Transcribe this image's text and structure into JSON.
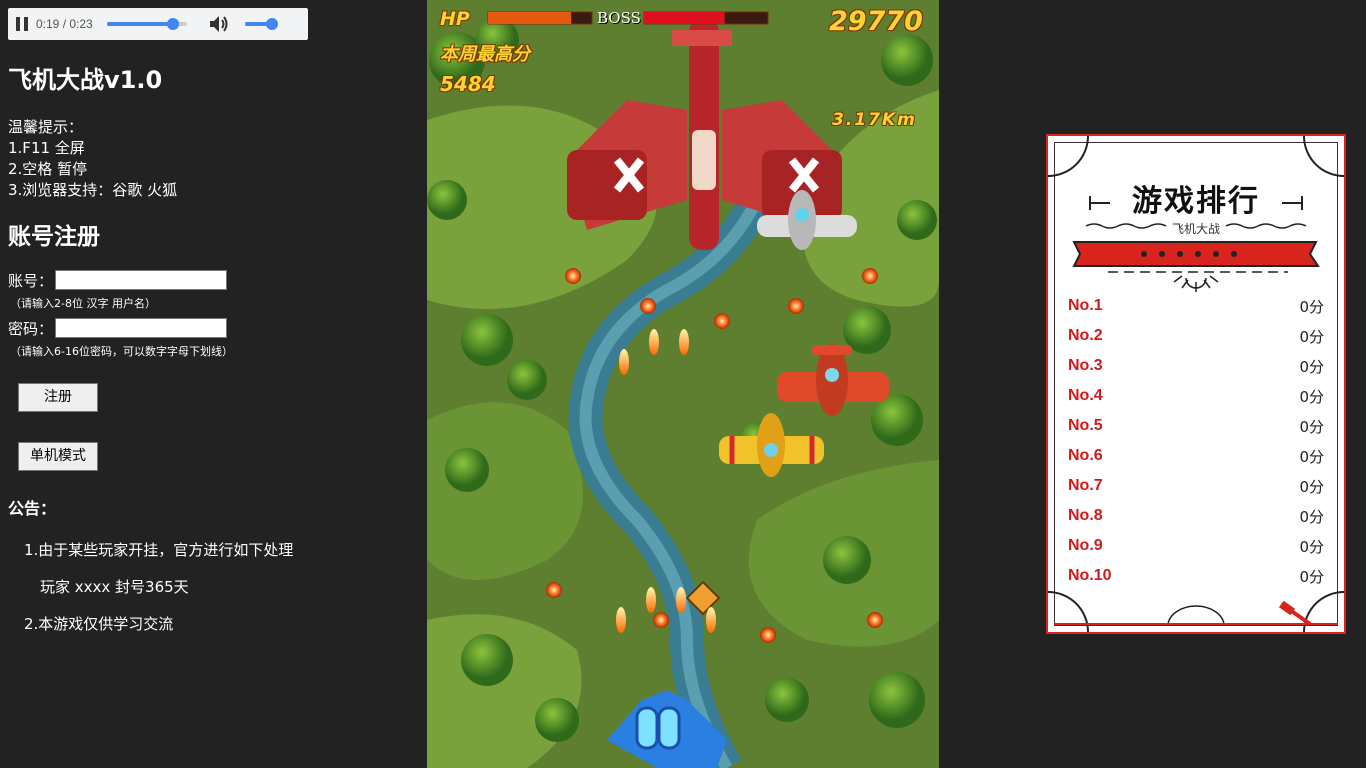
{
  "player": {
    "time": "0:19 / 0:23",
    "progress": 0.83,
    "volume": 0.9
  },
  "left": {
    "title": "飞机大战v1.0",
    "tips": [
      "温馨提示：",
      "1.F11 全屏",
      "2.空格 暂停",
      "3.浏览器支持：谷歌 火狐"
    ],
    "register_heading": "账号注册",
    "account_label": "账号：",
    "account_value": "",
    "account_hint": "（请输入2-8位 汉字 用户名）",
    "password_label": "密码：",
    "password_value": "",
    "password_hint": "（请输入6-16位密码，可以数字字母下划线）",
    "register_button": "注册",
    "single_mode_button": "单机模式",
    "notice_heading": "公告：",
    "notice_1": "1.由于某些玩家开挂，官方进行如下处理",
    "notice_1_detail": "玩家 xxxx 封号365天",
    "notice_2": "2.本游戏仅供学习交流"
  },
  "game": {
    "hp_label": "HP",
    "boss_label": "BOSS",
    "score": "29770",
    "weekly_best_label": "本周最高分",
    "weekly_best": "5484",
    "distance": "3.17Km",
    "player_hp": 0.8,
    "boss_hp": 0.65
  },
  "leaderboard": {
    "title": "游戏排行",
    "subtitle": "飞机大战",
    "ranks": [
      {
        "no": "No.1",
        "score": "0分"
      },
      {
        "no": "No.2",
        "score": "0分"
      },
      {
        "no": "No.3",
        "score": "0分"
      },
      {
        "no": "No.4",
        "score": "0分"
      },
      {
        "no": "No.5",
        "score": "0分"
      },
      {
        "no": "No.6",
        "score": "0分"
      },
      {
        "no": "No.7",
        "score": "0分"
      },
      {
        "no": "No.8",
        "score": "0分"
      },
      {
        "no": "No.9",
        "score": "0分"
      },
      {
        "no": "No.10",
        "score": "0分"
      }
    ]
  },
  "colors": {
    "page_bg": "#222222",
    "accent_red": "#d11a1a",
    "hud_gold": "#ffd233",
    "media_blue": "#4285f4"
  }
}
